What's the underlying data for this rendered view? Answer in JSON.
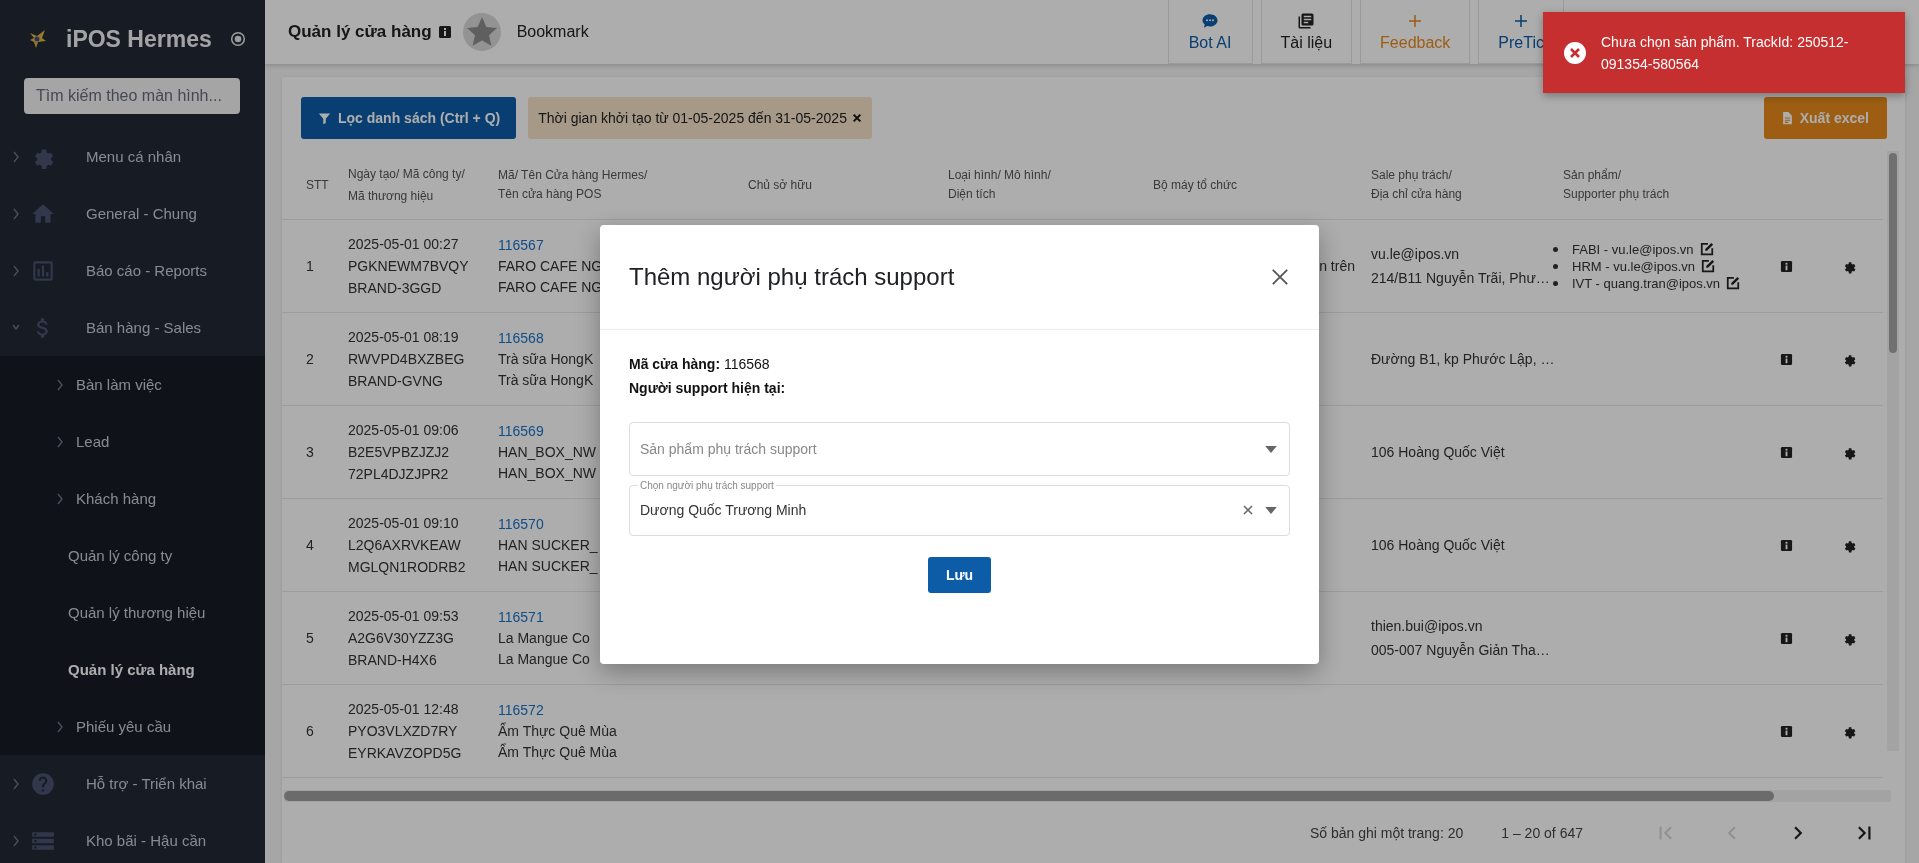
{
  "sidebar": {
    "brand": "iPOS Hermes",
    "search": {
      "placeholder": "Tìm kiếm theo màn hình..."
    },
    "items": [
      {
        "label": "Menu cá nhân",
        "expanded": false
      },
      {
        "label": "General - Chung",
        "expanded": false
      },
      {
        "label": "Báo cáo - Reports",
        "expanded": false
      },
      {
        "label": "Bán hàng - Sales",
        "expanded": true,
        "children": [
          {
            "label": "Bàn làm việc",
            "expandable": true,
            "selected": false
          },
          {
            "label": "Lead",
            "expandable": true,
            "selected": false
          },
          {
            "label": "Khách hàng",
            "expandable": true,
            "selected": false
          },
          {
            "label": "Quản lý công ty",
            "expandable": false,
            "selected": false
          },
          {
            "label": "Quản lý thương hiệu",
            "expandable": false,
            "selected": false
          },
          {
            "label": "Quản lý cửa hàng",
            "expandable": false,
            "selected": true
          },
          {
            "label": "Phiếu yêu cầu",
            "expandable": true,
            "selected": false
          }
        ]
      },
      {
        "label": "Hỗ trợ - Triển khai",
        "expanded": false
      },
      {
        "label": "Kho bãi - Hậu cần",
        "expanded": false
      }
    ]
  },
  "header": {
    "title": "Quản lý cửa hàng",
    "bookmark": "Bookmark",
    "actions": [
      {
        "label": "Bot AI"
      },
      {
        "label": "Tài liệu"
      },
      {
        "label": "Feedback"
      },
      {
        "label": "PreTic"
      }
    ]
  },
  "toast": {
    "message": "Chưa chọn sản phẩm. TrackId: 250512-091354-580564"
  },
  "toolbar": {
    "filter_button": "Lọc danh sách (Ctrl + Q)",
    "filter_chip": "Thời gian khởi tạo từ 01-05-2025 đến 31-05-2025",
    "export_button": "Xuất excel"
  },
  "table": {
    "columns": [
      {
        "lines": [
          "STT"
        ]
      },
      {
        "lines": [
          "Ngày tạo/ Mã công ty/",
          "Mã thương hiệu"
        ]
      },
      {
        "lines": [
          "Mã/ Tên Cửa hàng Hermes/",
          "Tên cửa hàng POS"
        ]
      },
      {
        "lines": [
          "Chủ sở hữu"
        ]
      },
      {
        "lines": [
          "Loại hình/ Mô hình/",
          "Diện tích"
        ]
      },
      {
        "lines": [
          "Bộ máy tổ chức"
        ]
      },
      {
        "lines": [
          "Sale phụ trách/",
          "Địa chỉ cửa hàng"
        ]
      },
      {
        "lines": [
          "Sản phẩm/",
          "Supporter phụ trách"
        ]
      }
    ],
    "rows": [
      {
        "stt": "1",
        "created": [
          "2025-05-01 00:27",
          "PGKNEWM7BVQY",
          "BRAND-3GGD"
        ],
        "store_id": "116567",
        "store_names": [
          "FARO CAFE NG",
          "FARO CAFE NG"
        ],
        "org": "n trên",
        "sale": [
          "vu.le@ipos.vn",
          "214/B11 Nguyễn Trãi, Phư…"
        ],
        "products": [
          "FABI - vu.le@ipos.vn",
          "HRM - vu.le@ipos.vn",
          "IVT - quang.tran@ipos.vn"
        ]
      },
      {
        "stt": "2",
        "created": [
          "2025-05-01 08:19",
          "RWVPD4BXZBEG",
          "BRAND-GVNG"
        ],
        "store_id": "116568",
        "store_names": [
          "Trà sữa HongK",
          "Trà sữa HongK"
        ],
        "sale": [
          "Đường B1, kp Phước Lập, …"
        ]
      },
      {
        "stt": "3",
        "created": [
          "2025-05-01 09:06",
          "B2E5VPBZJZJ2",
          "72PL4DJZJPR2"
        ],
        "store_id": "116569",
        "store_names": [
          "HAN_BOX_NW",
          "HAN_BOX_NW"
        ],
        "sale": [
          "106 Hoàng Quốc Việt"
        ]
      },
      {
        "stt": "4",
        "created": [
          "2025-05-01 09:10",
          "L2Q6AXRVKEAW",
          "MGLQN1RODRB2"
        ],
        "store_id": "116570",
        "store_names": [
          "HAN SUCKER_",
          "HAN SUCKER_"
        ],
        "sale": [
          "106 Hoàng Quốc Việt"
        ]
      },
      {
        "stt": "5",
        "created": [
          "2025-05-01 09:53",
          "A2G6V30YZZ3G",
          "BRAND-H4X6"
        ],
        "store_id": "116571",
        "store_names": [
          "La Mangue Co",
          "La Mangue Co"
        ],
        "sale": [
          "thien.bui@ipos.vn",
          "005-007 Nguyễn Giản Tha…"
        ]
      },
      {
        "stt": "6",
        "created": [
          "2025-05-01 12:48",
          "PYO3VLXZD7RY",
          "EYRKAVZOPD5G"
        ],
        "store_id": "116572",
        "store_names": [
          "Ẩm Thực Quê Mùa",
          "Ẩm Thực Quê Mùa"
        ]
      }
    ]
  },
  "footer": {
    "page_size": "Số bản ghi một trang: 20",
    "range": "1 – 20 of 647",
    "pager": [
      {
        "kind": "first",
        "disabled": true
      },
      {
        "kind": "prev",
        "disabled": true
      },
      {
        "kind": "next",
        "disabled": false
      },
      {
        "kind": "last",
        "disabled": false
      }
    ]
  },
  "modal": {
    "title": "Thêm người phụ trách support",
    "store_code": "**Mã cửa hàng:** 116568",
    "current_support": "Người support hiện tại:",
    "product_select": {
      "placeholder": "Sản phẩm phụ trách support"
    },
    "person_select": {
      "label": "Chọn người phụ trách support",
      "value": "Dương Quốc Trương Minh"
    },
    "save_button": "Lưu"
  }
}
